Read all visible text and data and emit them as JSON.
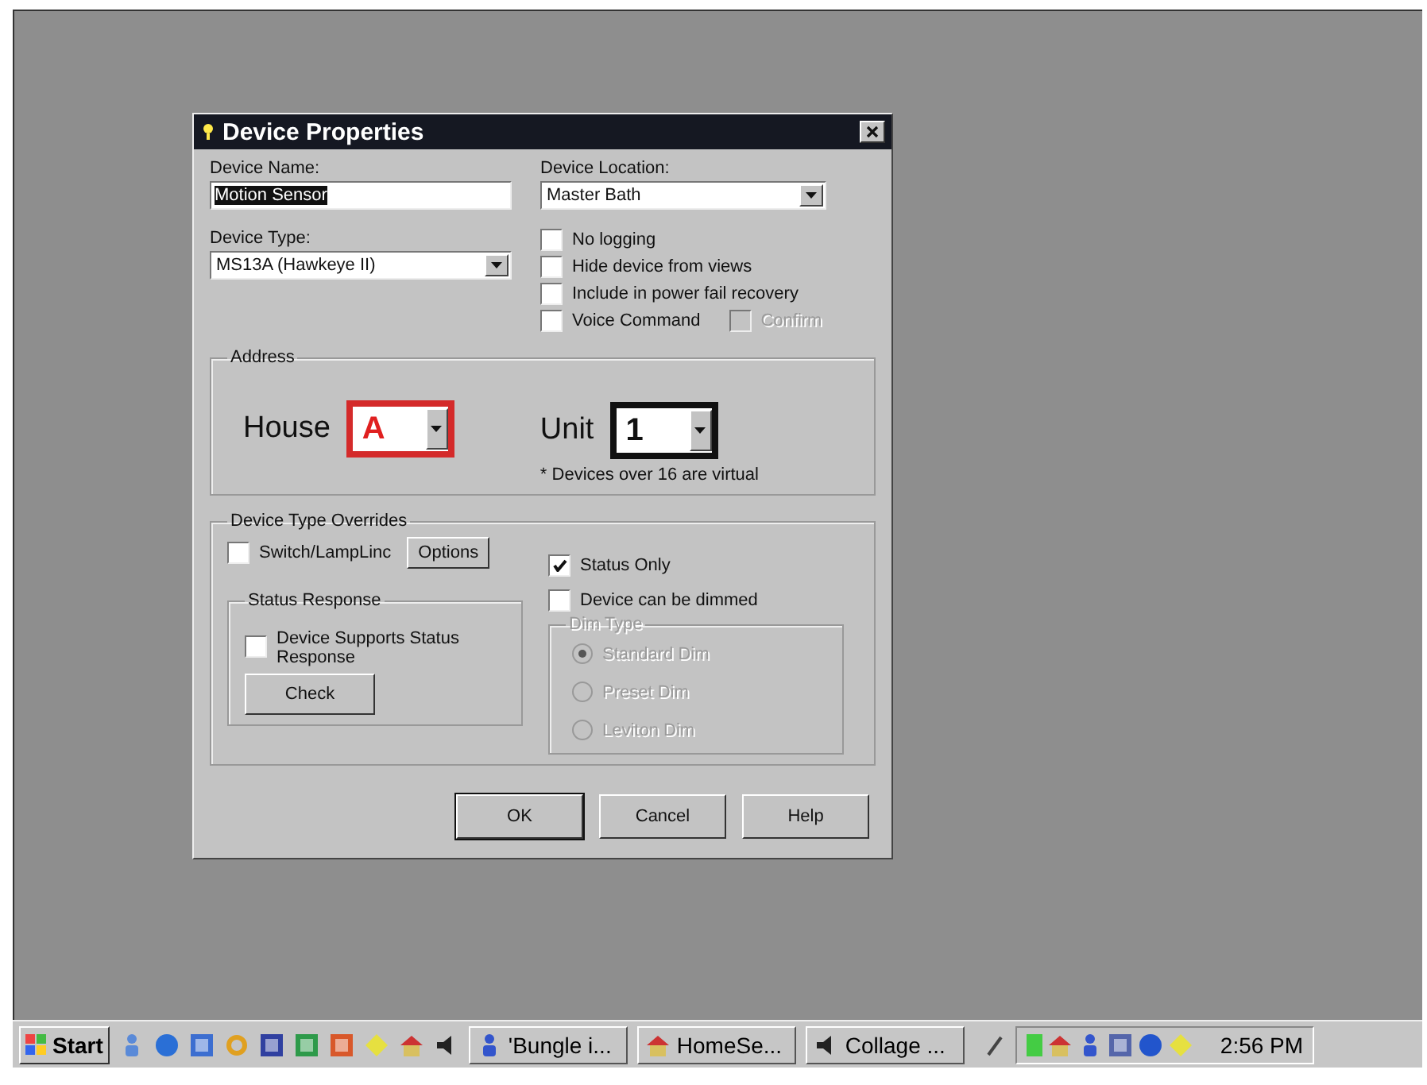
{
  "window": {
    "title": "Device Properties"
  },
  "device_name": {
    "label": "Device Name:",
    "value": "Motion Sensor"
  },
  "device_location": {
    "label": "Device Location:",
    "value": "Master Bath"
  },
  "device_type": {
    "label": "Device Type:",
    "value": "MS13A (Hawkeye II)"
  },
  "options": [
    {
      "label": "No logging",
      "checked": false,
      "disabled": false
    },
    {
      "label": "Hide device from views",
      "checked": false,
      "disabled": false
    },
    {
      "label": "Include in power fail recovery",
      "checked": false,
      "disabled": false
    },
    {
      "label": "Voice Command",
      "checked": false,
      "disabled": false
    },
    {
      "label": "Confirm",
      "checked": false,
      "disabled": true
    }
  ],
  "address": {
    "title": "Address",
    "house_label": "House",
    "house_value": "A",
    "unit_label": "Unit",
    "unit_value": "1",
    "note": "* Devices over 16 are virtual"
  },
  "overrides": {
    "title": "Device Type Overrides",
    "switch_lamplinc": {
      "label": "Switch/LampLinc",
      "checked": false
    },
    "options_button": "Options",
    "status_only": {
      "label": "Status Only",
      "checked": true
    },
    "dimmed": {
      "label": "Device can be dimmed",
      "checked": false
    },
    "status_response": {
      "title": "Status Response",
      "checkbox": {
        "label": "Device Supports Status Response",
        "checked": false
      },
      "button": "Check"
    },
    "dim_type": {
      "title": "Dim Type",
      "disabled": true,
      "radios": [
        {
          "label": "Standard Dim",
          "selected": true
        },
        {
          "label": "Preset Dim",
          "selected": false
        },
        {
          "label": "Leviton Dim",
          "selected": false
        }
      ]
    }
  },
  "buttons": [
    "OK",
    "Cancel",
    "Help"
  ],
  "taskbar": {
    "start": "Start",
    "tasks": [
      "'Bungle i...",
      "HomeSe...",
      "Collage ..."
    ],
    "clock": "2:56 PM"
  }
}
